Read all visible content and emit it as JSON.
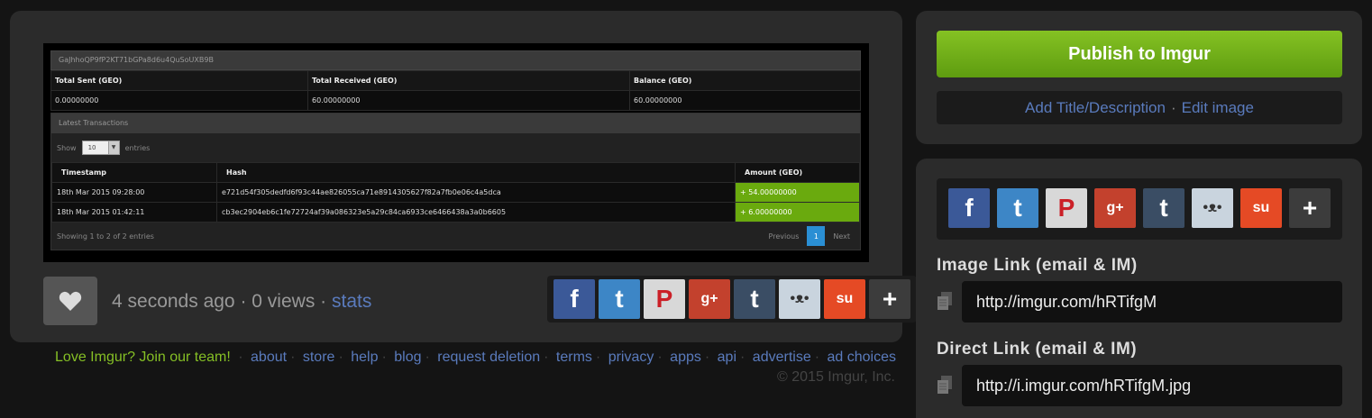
{
  "post_image": {
    "address": "GaJhhoQP9fP2KT71bGPa8d6u4QuSoUXB9B",
    "summary_headers": [
      "Total Sent (GEO)",
      "Total Received (GEO)",
      "Balance (GEO)"
    ],
    "summary_values": [
      "0.00000000",
      "60.00000000",
      "60.00000000"
    ],
    "latest_title": "Latest Transactions",
    "show_label": "Show",
    "show_value": "10",
    "entries_label": "entries",
    "tx_headers": [
      "Timestamp",
      "Hash",
      "Amount (GEO)"
    ],
    "tx_rows": [
      [
        "18th Mar 2015 09:28:00",
        "e721d54f305dedfd6f93c44ae826055ca71e8914305627f82a7fb0e06c4a5dca",
        "+ 54.00000000"
      ],
      [
        "18th Mar 2015 01:42:11",
        "cb3ec2904eb6c1fe72724af39a086323e5a29c84ca6933ce6466438a3a0b6605",
        "+ 6.00000000"
      ]
    ],
    "showing_text": "Showing 1 to 2 of 2 entries",
    "pager": {
      "previous": "Previous",
      "current": "1",
      "next": "Next"
    }
  },
  "meta": {
    "time": "4 seconds ago",
    "views": "0 views",
    "stats": "stats",
    "separator": "·"
  },
  "share_icons": [
    {
      "icon": "facebook-icon",
      "glyph": "f",
      "color": "#3b5998"
    },
    {
      "icon": "twitter-icon",
      "glyph": "t",
      "color": "#3d86c6"
    },
    {
      "icon": "pinterest-icon",
      "glyph": "P",
      "color": "#d8d8d8"
    },
    {
      "icon": "google-plus-icon",
      "glyph": "g+",
      "color": "#c3412d"
    },
    {
      "icon": "tumblr-icon",
      "glyph": "t",
      "color": "#3a4d64"
    },
    {
      "icon": "reddit-icon",
      "glyph": "•ᴥ•",
      "color": "#c9d4de"
    },
    {
      "icon": "stumbleupon-icon",
      "glyph": "su",
      "color": "#e54a25"
    },
    {
      "icon": "more-icon",
      "glyph": "+",
      "color": "#3c3c3c"
    }
  ],
  "footer": {
    "join": "Love Imgur? Join our team!",
    "links": [
      "about",
      "store",
      "help",
      "blog",
      "request deletion",
      "terms",
      "privacy",
      "apps",
      "api",
      "advertise",
      "ad choices"
    ],
    "copyright": "© 2015 Imgur, Inc."
  },
  "publish": {
    "label": "Publish to Imgur"
  },
  "edit": {
    "add_title": "Add Title/Description",
    "separator": "·",
    "edit_image": "Edit image"
  },
  "links": {
    "image_label": "Image Link (email & IM)",
    "image_url": "http://imgur.com/hRTifgM",
    "direct_label": "Direct Link (email & IM)",
    "direct_url": "http://i.imgur.com/hRTifgM.jpg"
  },
  "colors": {
    "accent_green": "#85bf25",
    "link_blue": "#5a7bbd",
    "amount_green": "#6aaa0e"
  }
}
